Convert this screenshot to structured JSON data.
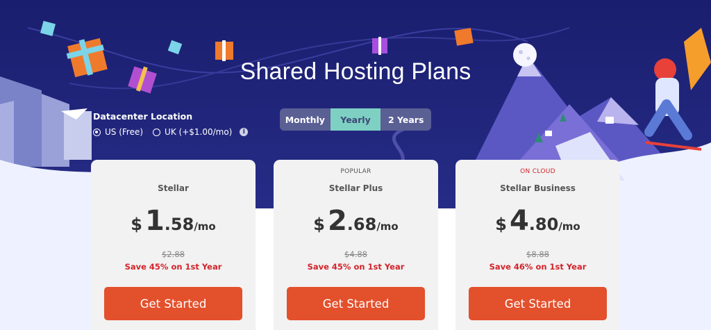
{
  "hero": {
    "title": "Shared Hosting Plans"
  },
  "datacenter": {
    "title": "Datacenter Location",
    "options": [
      {
        "label": "US (Free)",
        "selected": true
      },
      {
        "label": "UK (+$1.00/mo)",
        "selected": false
      }
    ],
    "info_icon": "info-icon"
  },
  "billing_toggle": {
    "options": [
      "Monthly",
      "Yearly",
      "2 Years"
    ],
    "active": "Yearly"
  },
  "plans": [
    {
      "badge": "",
      "name": "Stellar",
      "currency": "$",
      "price_int": "1",
      "price_dec": ".58",
      "unit": "/mo",
      "old_price": "$2.88",
      "save": "Save 45% on 1st Year",
      "cta": "Get Started"
    },
    {
      "badge": "POPULAR",
      "name": "Stellar Plus",
      "currency": "$",
      "price_int": "2",
      "price_dec": ".68",
      "unit": "/mo",
      "old_price": "$4.88",
      "save": "Save 45% on 1st Year",
      "cta": "Get Started"
    },
    {
      "badge": "ON CLOUD",
      "name": "Stellar Business",
      "currency": "$",
      "price_int": "4",
      "price_dec": ".80",
      "unit": "/mo",
      "old_price": "$8.88",
      "save": "Save 46% on 1st Year",
      "cta": "Get Started"
    }
  ],
  "colors": {
    "hero_bg": "#1c2173",
    "accent_toggle": "#7ed0c3",
    "cta": "#e3502c",
    "save_text": "#d2232a"
  }
}
